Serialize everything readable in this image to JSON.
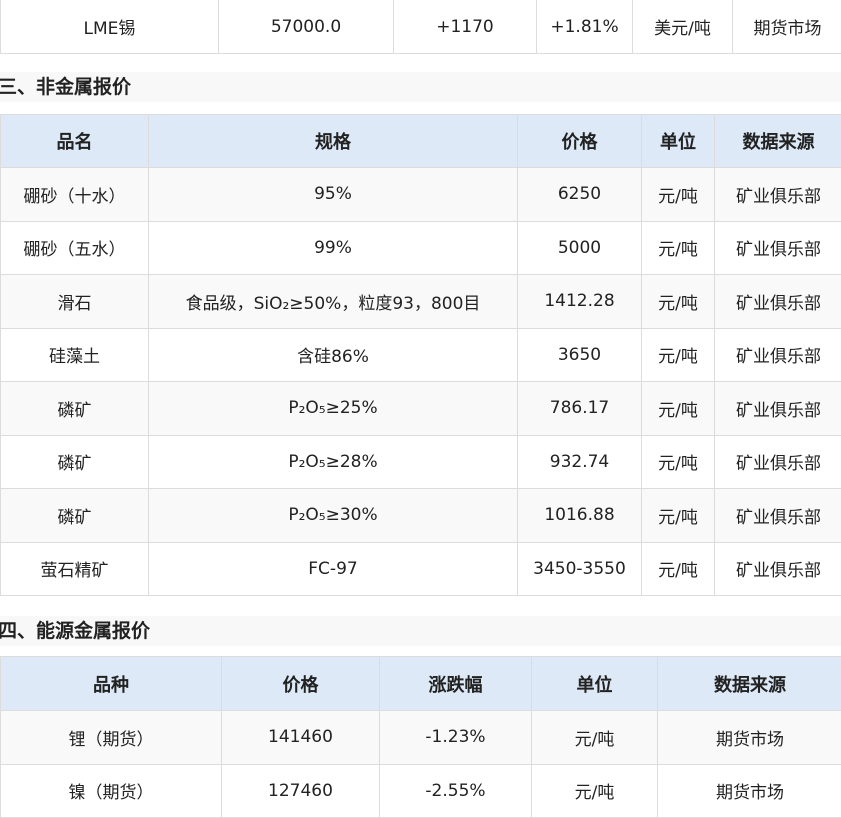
{
  "top_table": {
    "row": [
      "LME锡",
      "57000.0",
      "+1170",
      "+1.81%",
      "美元/吨",
      "期货市场"
    ]
  },
  "section3": {
    "title": "三、非金属报价",
    "headers": [
      "品名",
      "规格",
      "价格",
      "单位",
      "数据来源"
    ],
    "rows": [
      [
        "硼砂（十水）",
        "95%",
        "6250",
        "元/吨",
        "矿业俱乐部"
      ],
      [
        "硼砂（五水）",
        "99%",
        "5000",
        "元/吨",
        "矿业俱乐部"
      ],
      [
        "滑石",
        "食品级，SiO₂≥50%，粒度93，800目",
        "1412.28",
        "元/吨",
        "矿业俱乐部"
      ],
      [
        "硅藻土",
        "含硅86%",
        "3650",
        "元/吨",
        "矿业俱乐部"
      ],
      [
        "磷矿",
        "P₂O₅≥25%",
        "786.17",
        "元/吨",
        "矿业俱乐部"
      ],
      [
        "磷矿",
        "P₂O₅≥28%",
        "932.74",
        "元/吨",
        "矿业俱乐部"
      ],
      [
        "磷矿",
        "P₂O₅≥30%",
        "1016.88",
        "元/吨",
        "矿业俱乐部"
      ],
      [
        "萤石精矿",
        "FC-97",
        "3450-3550",
        "元/吨",
        "矿业俱乐部"
      ]
    ]
  },
  "section4": {
    "title": "四、能源金属报价",
    "headers": [
      "品种",
      "价格",
      "涨跌幅",
      "单位",
      "数据来源"
    ],
    "rows": [
      [
        "锂（期货）",
        "141460",
        "-1.23%",
        "元/吨",
        "期货市场"
      ],
      [
        "镍（期货）",
        "127460",
        "-2.55%",
        "元/吨",
        "期货市场"
      ]
    ]
  }
}
